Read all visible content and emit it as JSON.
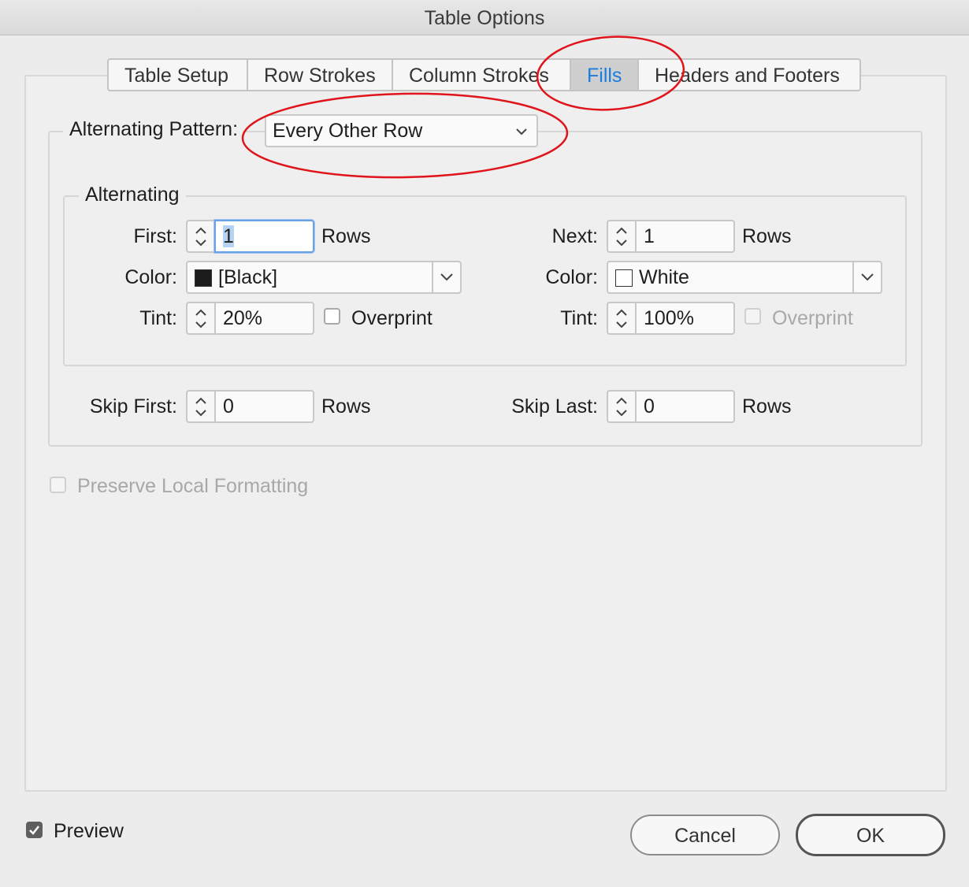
{
  "window": {
    "title": "Table Options"
  },
  "tabs": [
    {
      "label": "Table Setup",
      "active": false
    },
    {
      "label": "Row Strokes",
      "active": false
    },
    {
      "label": "Column Strokes",
      "active": false
    },
    {
      "label": "Fills",
      "active": true
    },
    {
      "label": "Headers and Footers",
      "active": false
    }
  ],
  "pattern": {
    "label": "Alternating Pattern:",
    "value": "Every Other Row"
  },
  "alternating": {
    "legend": "Alternating",
    "left": {
      "first_label": "First:",
      "first_value": "1",
      "first_unit": "Rows",
      "color_label": "Color:",
      "color_value": "[Black]",
      "swatch": "#1c1c1c",
      "tint_label": "Tint:",
      "tint_value": "20%",
      "overprint_label": "Overprint",
      "overprint_checked": false,
      "overprint_enabled": true
    },
    "right": {
      "next_label": "Next:",
      "next_value": "1",
      "next_unit": "Rows",
      "color_label": "Color:",
      "color_value": "White",
      "swatch": "#ffffff",
      "tint_label": "Tint:",
      "tint_value": "100%",
      "overprint_label": "Overprint",
      "overprint_checked": false,
      "overprint_enabled": false
    }
  },
  "skip": {
    "first_label": "Skip First:",
    "first_value": "0",
    "first_unit": "Rows",
    "last_label": "Skip Last:",
    "last_value": "0",
    "last_unit": "Rows"
  },
  "preserve": {
    "label": "Preserve Local Formatting",
    "checked": false,
    "enabled": false
  },
  "preview": {
    "label": "Preview",
    "checked": true
  },
  "buttons": {
    "cancel": "Cancel",
    "ok": "OK"
  },
  "annotation_color": "#e0141b",
  "accent_color": "#1a7ce0"
}
